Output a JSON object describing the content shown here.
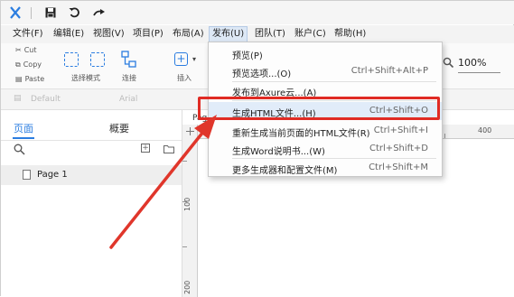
{
  "menubar": {
    "items": [
      {
        "label": "文件(F)",
        "active": false
      },
      {
        "label": "编辑(E)",
        "active": false
      },
      {
        "label": "视图(V)",
        "active": false
      },
      {
        "label": "项目(P)",
        "active": false
      },
      {
        "label": "布局(A)",
        "active": false
      },
      {
        "label": "发布(U)",
        "active": true
      },
      {
        "label": "团队(T)",
        "active": false
      },
      {
        "label": "账户(C)",
        "active": false
      },
      {
        "label": "帮助(H)",
        "active": false
      }
    ]
  },
  "toolbar": {
    "cut_label": "Cut",
    "copy_label": "Copy",
    "paste_label": "Paste",
    "select_mode_label": "选择模式",
    "connect_label": "连接",
    "insert_label": "插入",
    "zoom_value": "100%"
  },
  "formatbar": {
    "style_placeholder": "Default",
    "font_placeholder": "Arial"
  },
  "left_panel": {
    "tab_pages": "页面",
    "tab_overview": "概要",
    "page_item": "Page 1"
  },
  "canvas": {
    "tab_partial": "Pag",
    "ruler_top_label": "400",
    "ruler_left_labels": [
      "100",
      "200"
    ]
  },
  "publish_menu": {
    "items": [
      {
        "label": "预览(P)",
        "shortcut": ""
      },
      {
        "label": "预览选项...(O)",
        "shortcut": "Ctrl+Shift+Alt+P"
      },
      {
        "label": "发布到Axure云...(A)",
        "shortcut": ""
      },
      {
        "label": "生成HTML文件...(H)",
        "shortcut": "Ctrl+Shift+O",
        "highlighted": true
      },
      {
        "label": "重新生成当前页面的HTML文件(R)",
        "shortcut": "Ctrl+Shift+I"
      },
      {
        "label": "生成Word说明书...(W)",
        "shortcut": "Ctrl+Shift+D"
      },
      {
        "label": "更多生成器和配置文件(M)",
        "shortcut": "Ctrl+Shift+M"
      }
    ]
  },
  "colors": {
    "accent": "#2b7de0",
    "highlight_box": "#e02b24",
    "arrow": "#e0362b",
    "logo": "#2b7de0"
  }
}
